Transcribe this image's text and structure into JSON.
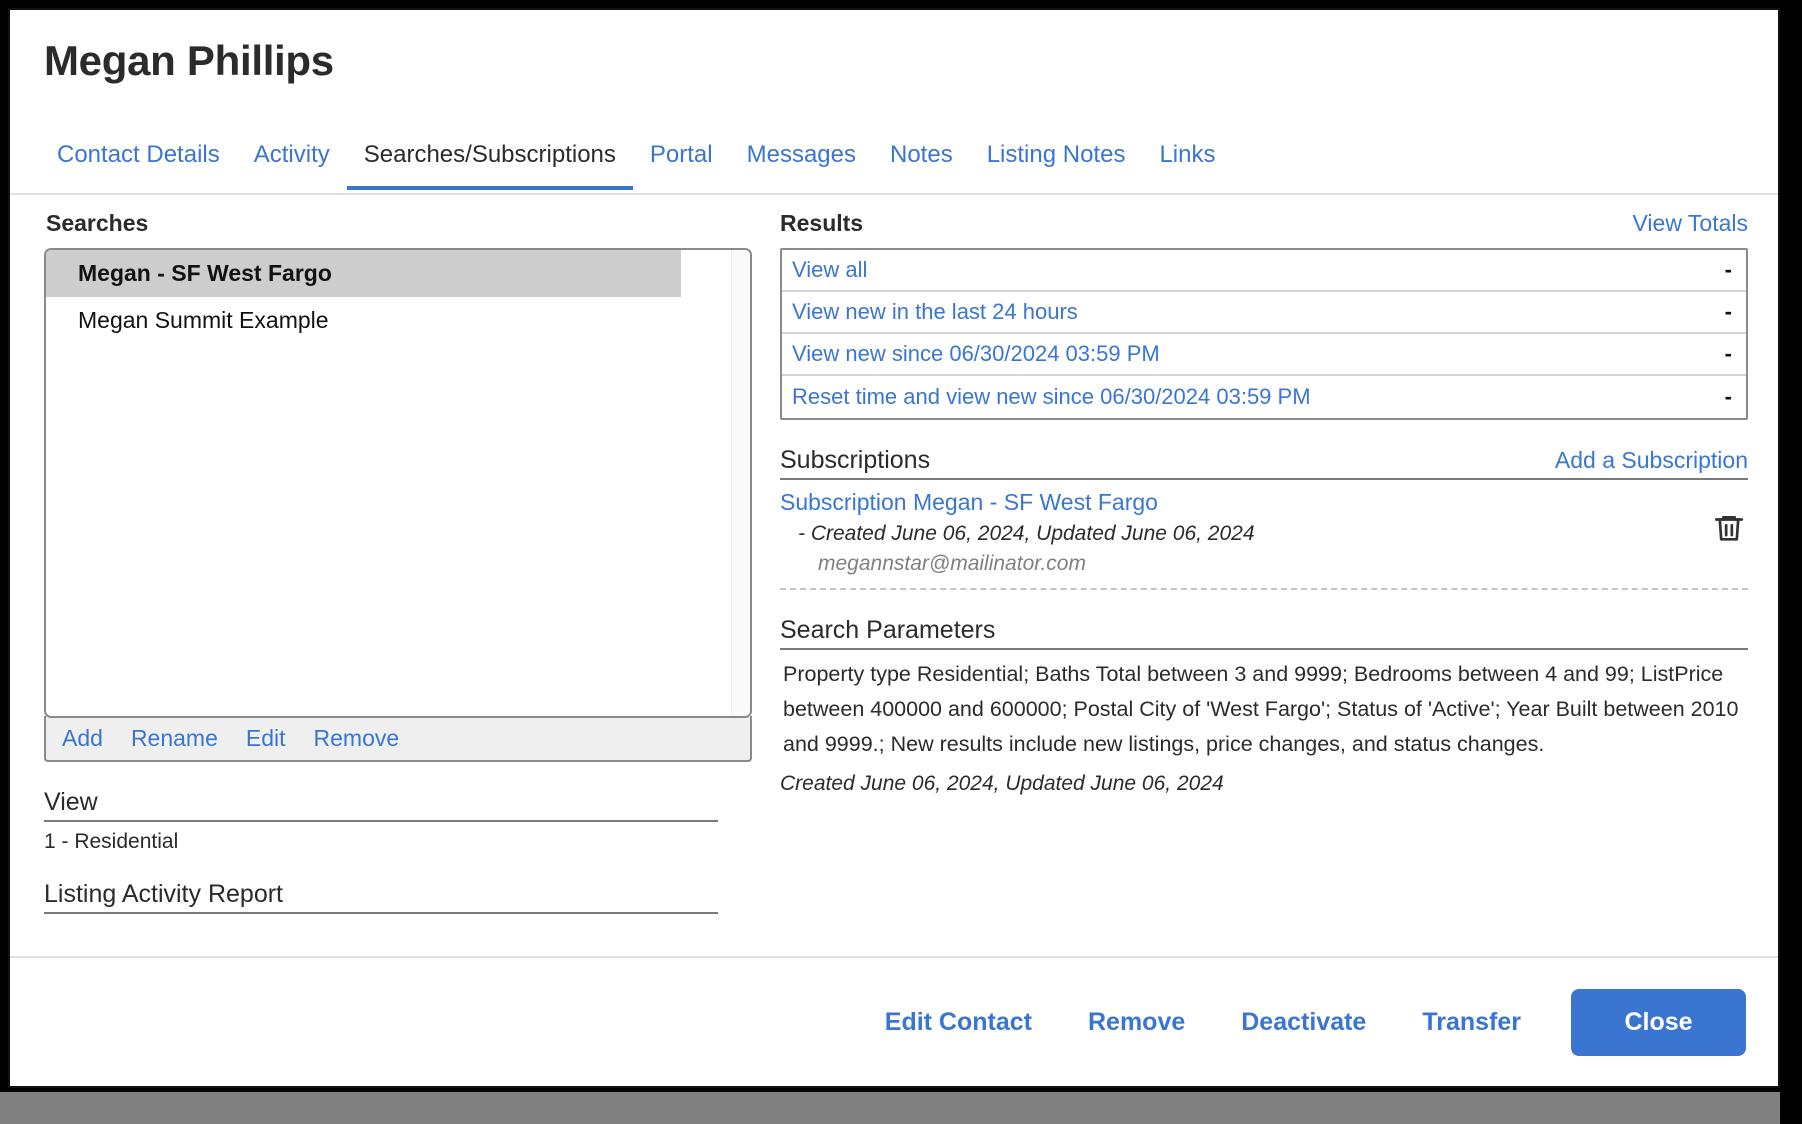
{
  "header": {
    "title": "Megan Phillips"
  },
  "tabs": [
    {
      "label": "Contact Details",
      "active": false
    },
    {
      "label": "Activity",
      "active": false
    },
    {
      "label": "Searches/Subscriptions",
      "active": true
    },
    {
      "label": "Portal",
      "active": false
    },
    {
      "label": "Messages",
      "active": false
    },
    {
      "label": "Notes",
      "active": false
    },
    {
      "label": "Listing Notes",
      "active": false
    },
    {
      "label": "Links",
      "active": false
    }
  ],
  "searches": {
    "heading": "Searches",
    "items": [
      {
        "label": "Megan - SF West Fargo",
        "selected": true
      },
      {
        "label": "Megan Summit Example",
        "selected": false
      }
    ],
    "toolbar": [
      {
        "label": "Add"
      },
      {
        "label": "Rename"
      },
      {
        "label": "Edit"
      },
      {
        "label": "Remove"
      }
    ],
    "view": {
      "label": "View",
      "value": "1 - Residential"
    },
    "listing_activity_report": {
      "label": "Listing Activity Report",
      "value": ""
    }
  },
  "results": {
    "heading": "Results",
    "view_totals_label": "View Totals",
    "rows": [
      {
        "label": "View all",
        "count": "-"
      },
      {
        "label": "View new in the last 24 hours",
        "count": "-"
      },
      {
        "label": "View new since 06/30/2024 03:59 PM",
        "count": "-"
      },
      {
        "label": "Reset time and view new since 06/30/2024 03:59 PM",
        "count": "-"
      }
    ]
  },
  "subscriptions": {
    "heading": "Subscriptions",
    "add_label": "Add a Subscription",
    "items": [
      {
        "name": "Subscription Megan - SF West Fargo",
        "meta": "- Created June 06, 2024, Updated June 06, 2024",
        "email": "megannstar@mailinator.com",
        "delete_icon": "trash-icon"
      }
    ]
  },
  "search_parameters": {
    "heading": "Search Parameters",
    "text": "Property type Residential; Baths Total between 3 and 9999; Bedrooms between 4 and 99; ListPrice between 400000 and 600000; Postal City of 'West Fargo'; Status of 'Active'; Year Built between 2010 and 9999.; New results include new listings, price changes, and status changes.",
    "meta": "Created June 06, 2024, Updated June 06, 2024"
  },
  "footer": {
    "links": [
      {
        "label": "Edit Contact"
      },
      {
        "label": "Remove"
      },
      {
        "label": "Deactivate"
      },
      {
        "label": "Transfer"
      }
    ],
    "primary": {
      "label": "Close"
    }
  },
  "colors": {
    "accent": "#3a76d1",
    "text": "#2b2b2b",
    "selected_row": "#cdcdcd",
    "border": "#8a8a8a",
    "muted": "#808080"
  }
}
